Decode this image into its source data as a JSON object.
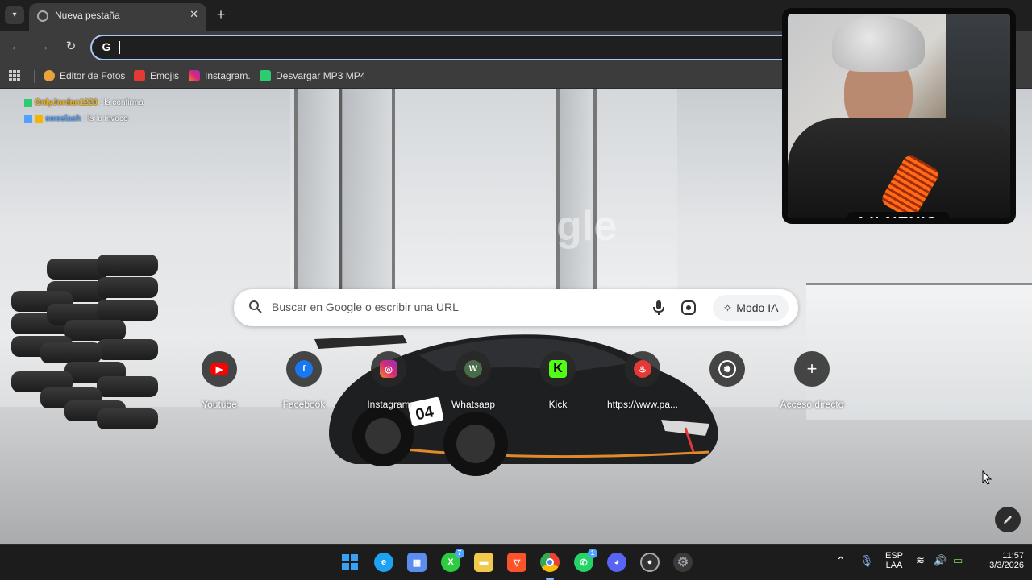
{
  "browser": {
    "tab": {
      "title": "Nueva pestaña"
    },
    "omnibox": {
      "value": ""
    },
    "bookmarks": [
      {
        "label": "Editor de Fotos",
        "icon": "photo-editor-icon",
        "color": "#e8a33c"
      },
      {
        "label": "Emojis",
        "icon": "lightning-icon",
        "color": "#e53935"
      },
      {
        "label": "Instagram.",
        "icon": "instagram-icon",
        "color": "#d62976"
      },
      {
        "label": "Desvargar MP3 MP4",
        "icon": "download-icon",
        "color": "#2ecc71"
      }
    ]
  },
  "chat_overlay": [
    {
      "user": "OnlyJordan1223",
      "message": ": ls confirma"
    },
    {
      "user": "sweslash",
      "message": ": ls lo invoco"
    }
  ],
  "ntp": {
    "logo_ghost": "gle",
    "search": {
      "placeholder": "Buscar en Google o escribir una URL",
      "ai_button": "Modo IA"
    },
    "shortcuts": [
      {
        "label": "Youtube",
        "icon": "youtube-icon",
        "color": "#ff0000"
      },
      {
        "label": "Facebook",
        "icon": "facebook-icon",
        "color": "#1877f2"
      },
      {
        "label": "Instagram",
        "icon": "instagram-icon",
        "color": "#d62976"
      },
      {
        "label": "Whatsaap",
        "icon": "whatsapp-icon",
        "color": "#4a6b4a"
      },
      {
        "label": "Kick",
        "icon": "kick-icon",
        "color": "#53fc18"
      },
      {
        "label": "https://www.pa...",
        "icon": "link-icon",
        "color": "#e53935"
      },
      {
        "label": "",
        "icon": "chatgpt-icon",
        "color": "#ffffff"
      },
      {
        "label": "Acceso directo",
        "icon": "plus-icon",
        "color": "#ffffff"
      }
    ]
  },
  "webcam": {
    "name": "LILNEXIS"
  },
  "taskbar": {
    "apps": [
      {
        "icon": "windows-start-icon",
        "color": "#3aa0f3"
      },
      {
        "icon": "edge-icon",
        "color": "#1fa1f1"
      },
      {
        "icon": "store-icon",
        "color": "#5b8def"
      },
      {
        "icon": "xbox-icon",
        "color": "#2ecc40",
        "badge": "7"
      },
      {
        "icon": "folder-icon",
        "color": "#f2c94c"
      },
      {
        "icon": "brave-icon",
        "color": "#fb542b"
      },
      {
        "icon": "chrome-icon",
        "color": "#34a853"
      },
      {
        "icon": "whatsapp-icon",
        "color": "#25d366",
        "badge": "1"
      },
      {
        "icon": "discord-icon",
        "color": "#5865f2"
      },
      {
        "icon": "obs-icon",
        "color": "#aaaaaa"
      },
      {
        "icon": "settings-icon",
        "color": "#9aa0a6"
      }
    ],
    "language": {
      "line1": "ESP",
      "line2": "LAA"
    },
    "clock": {
      "time": "11:57",
      "date": "3/3/2026"
    }
  }
}
